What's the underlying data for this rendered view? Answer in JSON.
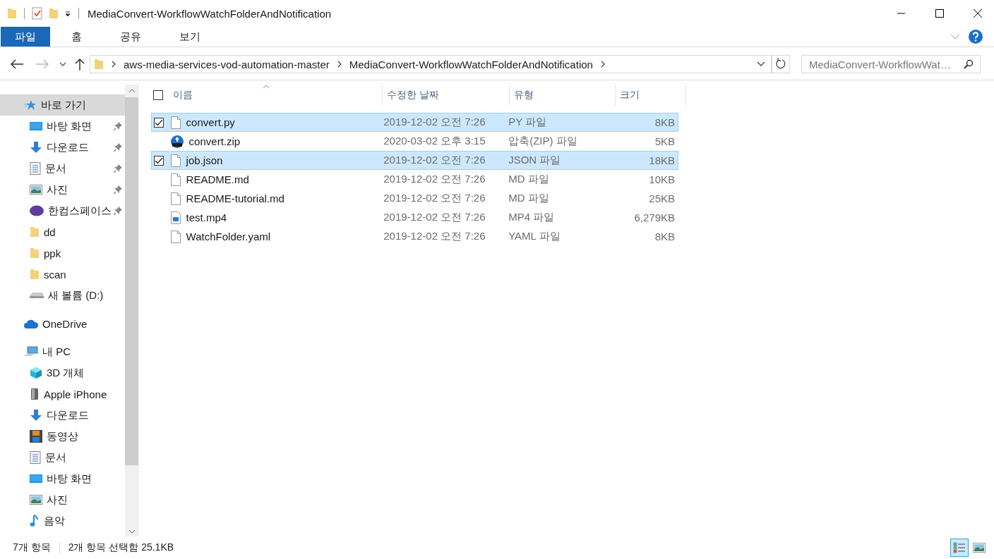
{
  "window": {
    "title": "MediaConvert-WorkflowWatchFolderAndNotification"
  },
  "ribbon": {
    "tabs": [
      {
        "label": "파일",
        "selected": true
      },
      {
        "label": "홈",
        "selected": false
      },
      {
        "label": "공유",
        "selected": false
      },
      {
        "label": "보기",
        "selected": false
      }
    ]
  },
  "address_bar": {
    "crumbs": [
      "aws-media-services-vod-automation-master",
      "MediaConvert-WorkflowWatchFolderAndNotification"
    ]
  },
  "search": {
    "placeholder": "MediaConvert-WorkflowWat…"
  },
  "sidebar": {
    "items": [
      {
        "label": "바로 가기",
        "kind": "quickaccess",
        "selected": true,
        "children": [
          {
            "label": "바탕 화면",
            "kind": "desktop",
            "pinned": true,
            "selected": false
          },
          {
            "label": "다운로드",
            "kind": "download",
            "pinned": true,
            "selected": false
          },
          {
            "label": "문서",
            "kind": "documents",
            "pinned": true,
            "selected": false
          },
          {
            "label": "사진",
            "kind": "pictures",
            "pinned": true,
            "selected": false
          },
          {
            "label": "한컴스페이스",
            "kind": "cloud-app",
            "pinned": true,
            "selected": false
          },
          {
            "label": "dd",
            "kind": "folder",
            "selected": false
          },
          {
            "label": "ppk",
            "kind": "folder",
            "selected": false
          },
          {
            "label": "scan",
            "kind": "folder",
            "selected": false
          },
          {
            "label": "새 볼륨 (D:)",
            "kind": "drive",
            "selected": false
          }
        ]
      },
      {
        "label": "OneDrive",
        "kind": "onedrive",
        "selected": false
      },
      {
        "label": "내 PC",
        "kind": "pc",
        "selected": false,
        "children": [
          {
            "label": "3D 개체",
            "kind": "objects3d",
            "selected": false
          },
          {
            "label": "Apple iPhone",
            "kind": "phone",
            "selected": false
          },
          {
            "label": "다운로드",
            "kind": "download",
            "selected": false
          },
          {
            "label": "동영상",
            "kind": "videos",
            "selected": false
          },
          {
            "label": "문서",
            "kind": "documents",
            "selected": false
          },
          {
            "label": "바탕 화면",
            "kind": "desktop",
            "selected": false
          },
          {
            "label": "사진",
            "kind": "pictures",
            "selected": false
          },
          {
            "label": "음악",
            "kind": "music",
            "selected": false
          }
        ]
      }
    ]
  },
  "file_list": {
    "select_all_checked": false,
    "columns": [
      {
        "label": "이름",
        "sorted": true
      },
      {
        "label": "수정한 날짜"
      },
      {
        "label": "유형"
      },
      {
        "label": "크기"
      }
    ],
    "rows": [
      {
        "name": "convert.py",
        "kind": "file",
        "date": "2019-12-02 오전 7:26",
        "type": "PY 파일",
        "size": "8KB",
        "selected": true
      },
      {
        "name": "convert.zip",
        "kind": "zip",
        "date": "2020-03-02 오후 3:15",
        "type": "압축(ZIP) 파일",
        "size": "5KB",
        "selected": false
      },
      {
        "name": "job.json",
        "kind": "file",
        "date": "2019-12-02 오전 7:26",
        "type": "JSON 파일",
        "size": "18KB",
        "selected": true
      },
      {
        "name": "README.md",
        "kind": "file",
        "date": "2019-12-02 오전 7:26",
        "type": "MD 파일",
        "size": "10KB",
        "selected": false
      },
      {
        "name": "README-tutorial.md",
        "kind": "file",
        "date": "2019-12-02 오전 7:26",
        "type": "MD 파일",
        "size": "25KB",
        "selected": false
      },
      {
        "name": "test.mp4",
        "kind": "video",
        "date": "2019-12-02 오전 7:26",
        "type": "MP4 파일",
        "size": "6,279KB",
        "selected": false
      },
      {
        "name": "WatchFolder.yaml",
        "kind": "file",
        "date": "2019-12-02 오전 7:26",
        "type": "YAML 파일",
        "size": "8KB",
        "selected": false
      }
    ]
  },
  "status_bar": {
    "item_count": "7개 항목",
    "selection": "2개 항목 선택함 25.1KB",
    "views": [
      {
        "kind": "details",
        "selected": true
      },
      {
        "kind": "large-icons",
        "selected": false
      }
    ]
  }
}
